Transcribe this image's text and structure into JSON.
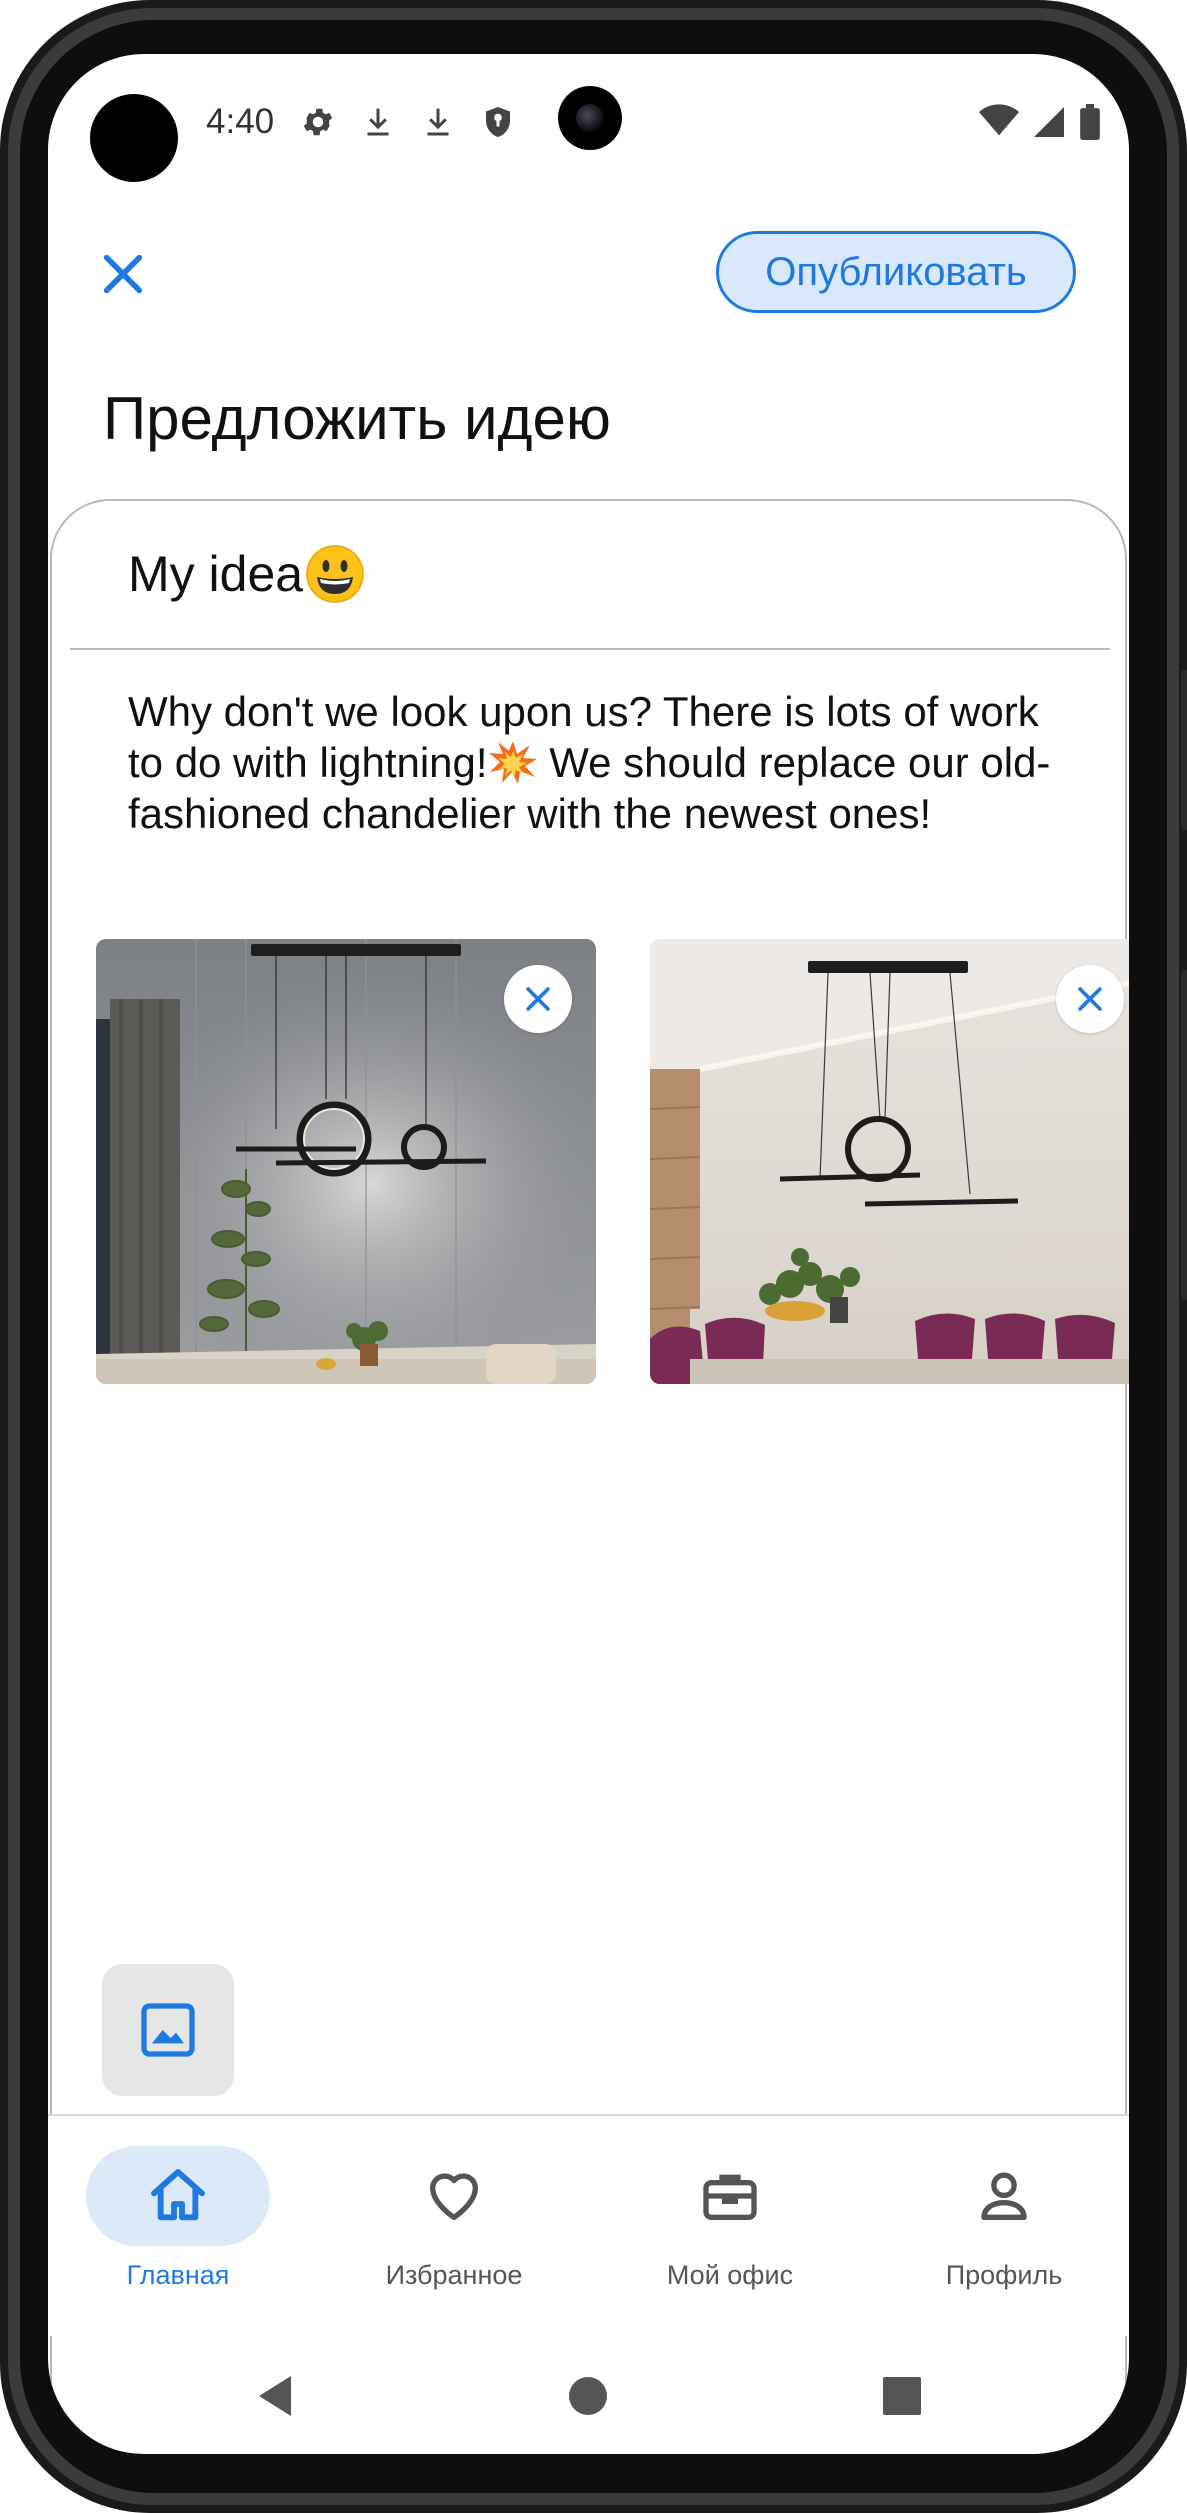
{
  "status_bar": {
    "time": "4:40",
    "icons": [
      "settings-icon",
      "download-icon",
      "download-icon",
      "shield-icon"
    ],
    "right_icons": [
      "wifi-icon",
      "signal-icon",
      "battery-icon"
    ]
  },
  "header": {
    "close_icon": "close-icon",
    "publish_label": "Опубликовать",
    "title": "Предложить идею"
  },
  "editor": {
    "title_text": "My idea",
    "title_emoji": "grinning-face-emoji",
    "body_part1": "Why don't we look upon us? There is lots of work to do with lightning!",
    "body_emoji": "collision-emoji",
    "body_part2": " We should replace our old-fashioned chandelier with the newest ones!"
  },
  "photos": [
    {
      "name": "chandelier-photo-1"
    },
    {
      "name": "chandelier-photo-2"
    }
  ],
  "attach_icon": "image-icon",
  "bottom_nav": {
    "items": [
      {
        "label": "Главная",
        "icon": "home-icon",
        "active": true
      },
      {
        "label": "Избранное",
        "icon": "heart-icon",
        "active": false
      },
      {
        "label": "Мой офис",
        "icon": "briefcase-icon",
        "active": false
      },
      {
        "label": "Профиль",
        "icon": "person-icon",
        "active": false
      }
    ]
  },
  "colors": {
    "accent": "#1f7ae0",
    "accent_light": "#d9e9fb",
    "text": "#111111"
  }
}
